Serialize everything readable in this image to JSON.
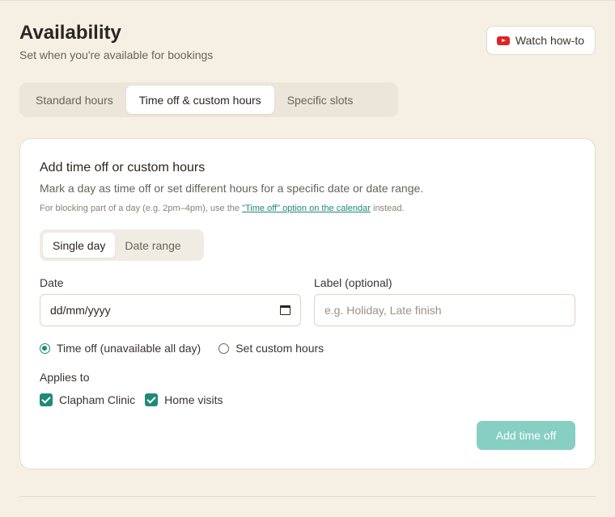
{
  "header": {
    "title": "Availability",
    "subtitle": "Set when you're available for bookings",
    "watch_label": "Watch how-to"
  },
  "tabs": [
    {
      "label": "Standard hours",
      "active": false
    },
    {
      "label": "Time off & custom hours",
      "active": true
    },
    {
      "label": "Specific slots",
      "active": false
    }
  ],
  "card": {
    "title": "Add time off or custom hours",
    "description": "Mark a day as time off or set different hours for a specific date or date range.",
    "note_prefix": "For blocking part of a day (e.g. 2pm–4pm), use the ",
    "note_link": "\"Time off\" option on the calendar",
    "note_suffix": " instead.",
    "mode": {
      "single": "Single day",
      "range": "Date range",
      "selected": "Single day"
    },
    "date": {
      "label": "Date",
      "value": "dd/mm/yyyy"
    },
    "label_field": {
      "label": "Label (optional)",
      "placeholder": "e.g. Holiday, Late finish"
    },
    "radios": [
      {
        "label": "Time off (unavailable all day)",
        "checked": true
      },
      {
        "label": "Set custom hours",
        "checked": false
      }
    ],
    "applies_to": {
      "label": "Applies to",
      "options": [
        {
          "label": "Clapham Clinic",
          "checked": true
        },
        {
          "label": "Home visits",
          "checked": true
        }
      ]
    },
    "submit_label": "Add time off"
  },
  "colors": {
    "accent": "#1f8a76",
    "button_disabled": "#88cfc3",
    "background": "#f5efe4"
  }
}
